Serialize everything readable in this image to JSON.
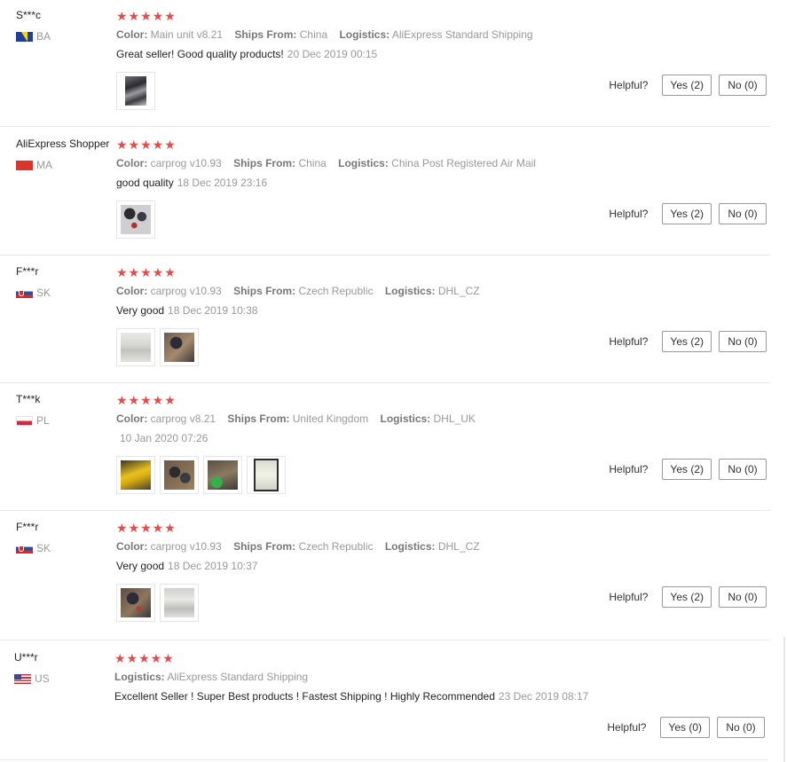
{
  "reviews": [
    {
      "user": "S***c",
      "country": "BA",
      "flag": "bosnia-flag",
      "stars": "★★★★★",
      "color_label": "Color:",
      "color": "Main unit v8.21",
      "ships_label": "Ships From:",
      "ships": "China",
      "logistics_label": "Logistics:",
      "logistics": "AliExpress Standard Shipping",
      "comment": "Great seller! Good quality products!",
      "date": "20 Dec 2019 00:15",
      "helpful_label": "Helpful?",
      "yes": "Yes (2)",
      "no": "No (0)",
      "photos": [
        "product-photo"
      ]
    },
    {
      "user": "AliExpress Shopper",
      "country": "MA",
      "flag": "morocco-flag",
      "stars": "★★★★★",
      "color_label": "Color:",
      "color": "carprog v10.93",
      "ships_label": "Ships From:",
      "ships": "China",
      "logistics_label": "Logistics:",
      "logistics": "China Post Registered Air Mail",
      "comment": "good quality",
      "date": "18 Dec 2019 23:16",
      "helpful_label": "Helpful?",
      "yes": "Yes (2)",
      "no": "No (0)",
      "photos": [
        "product-photo"
      ]
    },
    {
      "user": "F***r",
      "country": "SK",
      "flag": "slovakia-flag",
      "stars": "★★★★★",
      "color_label": "Color:",
      "color": "carprog v10.93",
      "ships_label": "Ships From:",
      "ships": "Czech Republic",
      "logistics_label": "Logistics:",
      "logistics": "DHL_CZ",
      "comment": "Very good",
      "date": "18 Dec 2019 10:38",
      "helpful_label": "Helpful?",
      "yes": "Yes (2)",
      "no": "No (0)",
      "photos": [
        "product-photo",
        "product-photo"
      ]
    },
    {
      "user": "T***k",
      "country": "PL",
      "flag": "poland-flag",
      "stars": "★★★★★",
      "color_label": "Color:",
      "color": "carprog v8.21",
      "ships_label": "Ships From:",
      "ships": "United Kingdom",
      "logistics_label": "Logistics:",
      "logistics": "DHL_UK",
      "comment": "",
      "date": "10 Jan 2020 07:26",
      "helpful_label": "Helpful?",
      "yes": "Yes (2)",
      "no": "No (0)",
      "photos": [
        "product-photo",
        "product-photo",
        "product-photo",
        "product-photo"
      ]
    },
    {
      "user": "F***r",
      "country": "SK",
      "flag": "slovakia-flag",
      "stars": "★★★★★",
      "color_label": "Color:",
      "color": "carprog v10.93",
      "ships_label": "Ships From:",
      "ships": "Czech Republic",
      "logistics_label": "Logistics:",
      "logistics": "DHL_CZ",
      "comment": "Very good",
      "date": "18 Dec 2019 10:37",
      "helpful_label": "Helpful?",
      "yes": "Yes (2)",
      "no": "No (0)",
      "photos": [
        "product-photo",
        "product-photo"
      ]
    },
    {
      "user": "U***r",
      "country": "US",
      "flag": "usa-flag",
      "stars": "★★★★★",
      "logistics_label": "Logistics:",
      "logistics": "AliExpress Standard Shipping",
      "comment": "Excellent Seller ! Super Best products ! Fastest Shipping ! Highly Recommended",
      "date": "23 Dec 2019 08:17",
      "helpful_label": "Helpful?",
      "yes": "Yes (0)",
      "no": "No (0)",
      "photos": []
    }
  ]
}
